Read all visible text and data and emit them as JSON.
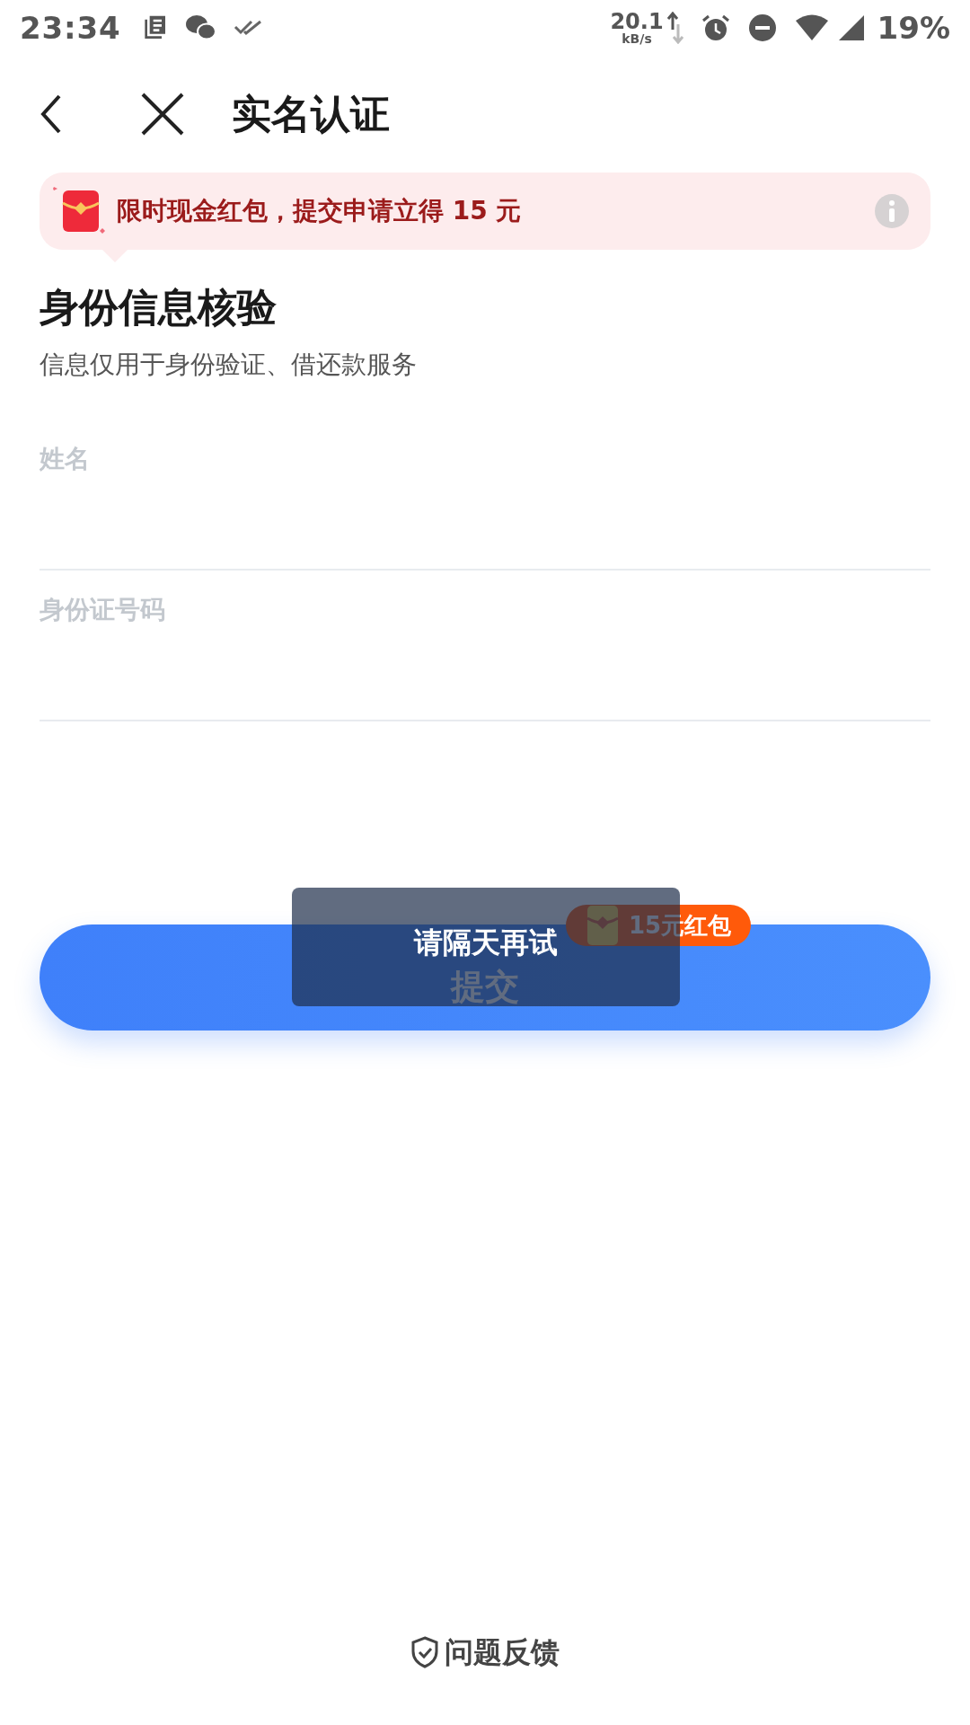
{
  "status_bar": {
    "time": "23:34",
    "net_speed": "20.1",
    "net_unit": "kB/s",
    "battery": "19%"
  },
  "header": {
    "title": "实名认证"
  },
  "banner": {
    "text": "限时现金红包，提交申请立得 15 元"
  },
  "section": {
    "title": "身份信息核验",
    "subtitle": "信息仅用于身份验证、借还款服务"
  },
  "fields": [
    {
      "placeholder": "姓名"
    },
    {
      "placeholder": "身份证号码"
    }
  ],
  "submit": {
    "label": "提交",
    "badge": "15元红包"
  },
  "toast": {
    "text": "请隔天再试"
  },
  "footer": {
    "link": "问题反馈"
  }
}
